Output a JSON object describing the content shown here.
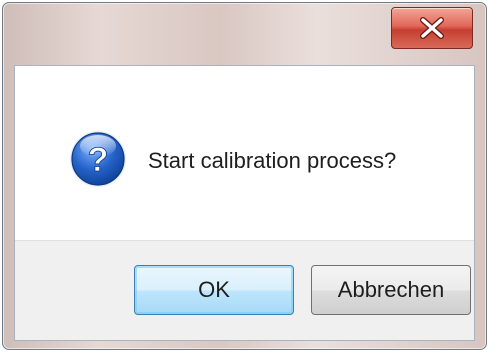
{
  "dialog": {
    "title": "",
    "close_icon": "close-icon",
    "message_icon": "question-icon",
    "message": "Start calibration process?",
    "buttons": {
      "ok_label": "OK",
      "cancel_label": "Abbrechen"
    },
    "colors": {
      "close_button": "#d9574a",
      "default_button_border": "#3c7fb1",
      "footer_background": "#f0f0f0",
      "icon_blue": "#1f5fb8"
    }
  }
}
